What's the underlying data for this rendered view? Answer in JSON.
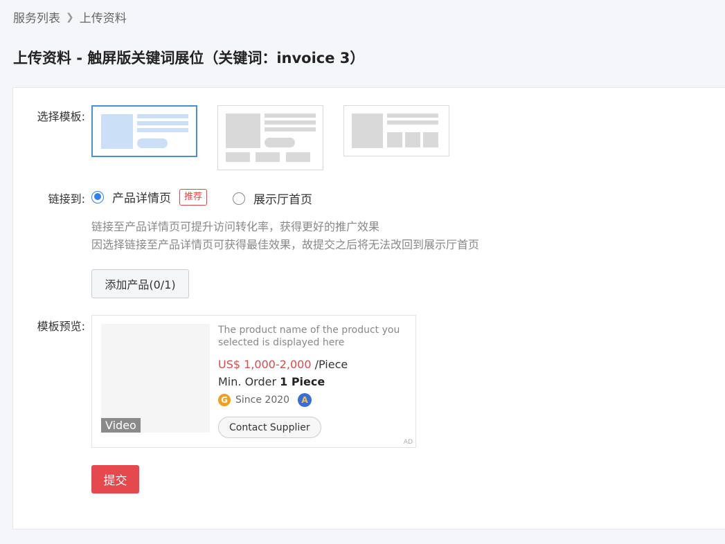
{
  "breadcrumb": {
    "parent": "服务列表",
    "current": "上传资料"
  },
  "page_title": "上传资料 - 触屏版关键词展位（关键词：invoice 3）",
  "form": {
    "template_label": "选择模板:",
    "link_label": "链接到:",
    "preview_label": "模板预览:",
    "link_options": [
      {
        "label": "产品详情页",
        "badge": "推荐",
        "selected": true
      },
      {
        "label": "展示厅首页",
        "selected": false
      }
    ],
    "hint_line1": "链接至产品详情页可提升访问转化率，获得更好的推广效果",
    "hint_line2": "因选择链接至产品详情页可获得最佳效果，故提交之后将无法改回到展示厅首页",
    "add_product_label": "添加产品(0/1)",
    "submit_label": "提交"
  },
  "preview": {
    "video_tag": "Video",
    "product_name": "The product name of the product you selected is displayed here",
    "price": "US$ 1,000-2,000",
    "price_unit": "/Piece",
    "moq_label": "Min. Order",
    "moq_value": "1 Piece",
    "since": "Since 2020",
    "contact_label": "Contact Supplier",
    "ad": "AD"
  },
  "colors": {
    "accent": "#2f80ed",
    "danger": "#e5484d",
    "selected_template": "#cbe0f7"
  }
}
